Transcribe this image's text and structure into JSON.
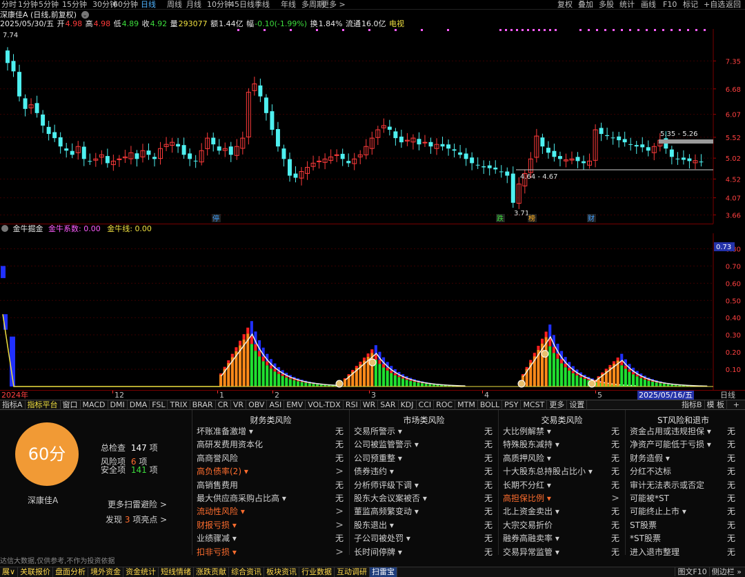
{
  "periods": [
    "分时",
    "1分钟",
    "5分钟",
    "15分钟",
    "30分钟",
    "60分钟",
    "日线",
    "周线",
    "月线",
    "10分钟",
    "45日线",
    "季线",
    "年线",
    "多周期",
    "更多 >"
  ],
  "active_period": "日线",
  "right_buttons": [
    "复权",
    "叠加",
    "多股",
    "统计",
    "画线",
    "F10",
    "标记",
    "+自选",
    "返回"
  ],
  "title": "深康佳A (日线,前复权)",
  "info": {
    "date": "2025/05/30/五",
    "open_label": "开",
    "open": "4.98",
    "high_label": "高",
    "high": "4.98",
    "low_label": "低",
    "low": "4.89",
    "close_label": "收",
    "close": "4.92",
    "vol_label": "量",
    "vol": "293077",
    "amt_label": "额",
    "amt": "1.44亿",
    "chg_label": "幅",
    "chg": "-0.10(-1.99%)",
    "turn_label": "换",
    "turn": "1.84%",
    "float_label": "流通",
    "float": "16.0亿",
    "tag": "电视"
  },
  "price_axis": [
    "7.35",
    "6.68",
    "6.07",
    "5.52",
    "5.02",
    "4.52",
    "4.07",
    "3.66"
  ],
  "price_annotations": {
    "high": "7.74",
    "low": "3.71",
    "range1": "5.35 - 5.26",
    "range2": "4.64 - 4.67"
  },
  "event_tags": [
    {
      "text": "停",
      "color": "#3fa0ff"
    },
    {
      "text": "跌",
      "color": "#3cdc3c"
    },
    {
      "text": "榜",
      "color": "#ffb020"
    },
    {
      "text": "财",
      "color": "#3fa0ff"
    }
  ],
  "indicator": {
    "name": "金牛掘金",
    "coef_label": "金牛系数:",
    "coef": "0.00",
    "line_label": "金牛线:",
    "line": "0.00",
    "axis": [
      "0.80",
      "0.70",
      "0.60",
      "0.50",
      "0.40",
      "0.30",
      "0.20",
      "0.10"
    ],
    "current": "0.73"
  },
  "time_axis": {
    "labels": [
      "2024年",
      "12",
      "1",
      "2",
      "3",
      "4",
      "5"
    ],
    "selected_date": "2025/05/16/五",
    "right_label": "日线"
  },
  "tabs": [
    "指标A",
    "指标平台",
    "窗口",
    "MACD",
    "DMI",
    "DMA",
    "FSL",
    "TRIX",
    "BRAR",
    "CR",
    "VR",
    "OBV",
    "ASI",
    "EMV",
    "VOL-TDX",
    "RSI",
    "WR",
    "SAR",
    "KDJ",
    "CCI",
    "ROC",
    "MTM",
    "BOLL",
    "PSY",
    "MCST",
    "更多",
    "设置"
  ],
  "active_tab": "指标平台",
  "tabs_right": [
    "指标B",
    "模 板"
  ],
  "scan": {
    "score": "60分",
    "stock_name": "深康佳A",
    "total_label": "总检查",
    "total": "147",
    "total_unit": "项",
    "risk_label": "风险项",
    "risk": "6",
    "risk_unit": "项",
    "safe_label": "安全项",
    "safe": "141",
    "safe_unit": "项",
    "more": "更多扫雷避险 >",
    "found_prefix": "发现",
    "found": "3",
    "found_suffix": "项亮点 >"
  },
  "categories": [
    {
      "title": "财务类风险",
      "items": [
        {
          "name": "坏账准备激增 ▾",
          "value": "无",
          "hi": false
        },
        {
          "name": "高研发费用资本化",
          "value": "无",
          "hi": false
        },
        {
          "name": "高商誉风险",
          "value": "无",
          "hi": false
        },
        {
          "name": "高负债率(2) ▾",
          "value": ">",
          "hi": true
        },
        {
          "name": "高销售费用",
          "value": "无",
          "hi": false
        },
        {
          "name": "最大供应商采购占比高 ▾",
          "value": "无",
          "hi": false
        },
        {
          "name": "流动性风险 ▾",
          "value": ">",
          "hi": true
        },
        {
          "name": "财报亏损 ▾",
          "value": ">",
          "hi": true
        },
        {
          "name": "业绩骤减 ▾",
          "value": "无",
          "hi": false
        },
        {
          "name": "扣非亏损 ▾",
          "value": ">",
          "hi": true
        }
      ]
    },
    {
      "title": "市场类风险",
      "items": [
        {
          "name": "交易所警示 ▾",
          "value": "无",
          "hi": false
        },
        {
          "name": "公司被监管警示 ▾",
          "value": "无",
          "hi": false
        },
        {
          "name": "公司预重整 ▾",
          "value": "无",
          "hi": false
        },
        {
          "name": "债券违约 ▾",
          "value": "无",
          "hi": false
        },
        {
          "name": "分析师评级下调 ▾",
          "value": "无",
          "hi": false
        },
        {
          "name": "股东大会议案被否 ▾",
          "value": "无",
          "hi": false
        },
        {
          "name": "董监高频繁变动 ▾",
          "value": "无",
          "hi": false
        },
        {
          "name": "股东退出 ▾",
          "value": "无",
          "hi": false
        },
        {
          "name": "子公司被处罚 ▾",
          "value": "无",
          "hi": false
        },
        {
          "name": "长时间停牌 ▾",
          "value": "无",
          "hi": false
        }
      ]
    },
    {
      "title": "交易类风险",
      "items": [
        {
          "name": "大比例解禁 ▾",
          "value": "无",
          "hi": false
        },
        {
          "name": "特殊股东减持 ▾",
          "value": "无",
          "hi": false
        },
        {
          "name": "高质押风险 ▾",
          "value": "无",
          "hi": false
        },
        {
          "name": "十大股东总持股占比小 ▾",
          "value": "无",
          "hi": false
        },
        {
          "name": "长期不分红 ▾",
          "value": "无",
          "hi": false
        },
        {
          "name": "高担保比例 ▾",
          "value": ">",
          "hi": true
        },
        {
          "name": "北上资金卖出 ▾",
          "value": "无",
          "hi": false
        },
        {
          "name": "大宗交易折价",
          "value": "无",
          "hi": false
        },
        {
          "name": "融券高融卖率 ▾",
          "value": "无",
          "hi": false
        },
        {
          "name": "交易异常监管 ▾",
          "value": "无",
          "hi": false
        }
      ]
    },
    {
      "title": "ST风险和退市",
      "items": [
        {
          "name": "资金占用或违规担保 ▾",
          "value": "无",
          "hi": false
        },
        {
          "name": "净资产可能低于亏损 ▾",
          "value": "无",
          "hi": false
        },
        {
          "name": "财务造假 ▾",
          "value": "无",
          "hi": false
        },
        {
          "name": "分红不达标",
          "value": "无",
          "hi": false
        },
        {
          "name": "审计无法表示或否定",
          "value": "无",
          "hi": false
        },
        {
          "name": "可能被*ST",
          "value": "无",
          "hi": false
        },
        {
          "name": "可能终止上市 ▾",
          "value": "无",
          "hi": false
        },
        {
          "name": "ST股票",
          "value": "无",
          "hi": false
        },
        {
          "name": "*ST股票",
          "value": "无",
          "hi": false
        },
        {
          "name": "进入退市整理",
          "value": "无",
          "hi": false
        }
      ]
    }
  ],
  "disclaimer": "达信大数据,仅供参考,不作为投资依据",
  "status_tabs": [
    "展∨",
    "关联报价",
    "盘面分析",
    "境外资金",
    "资金统计",
    "短线情绪",
    "涨跌贡献",
    "综合资讯",
    "板块资讯",
    "行业数据",
    "互动调研",
    "扫雷宝"
  ],
  "active_status": "扫雷宝",
  "status_right": [
    "图文F10",
    "侧边栏 »"
  ],
  "colors": {
    "up": "#ff3b3b",
    "down": "#4ef0f0",
    "accent_orange": "#f19a35",
    "axis_red": "#7a0000",
    "ma_white": "#e0e0e0"
  }
}
